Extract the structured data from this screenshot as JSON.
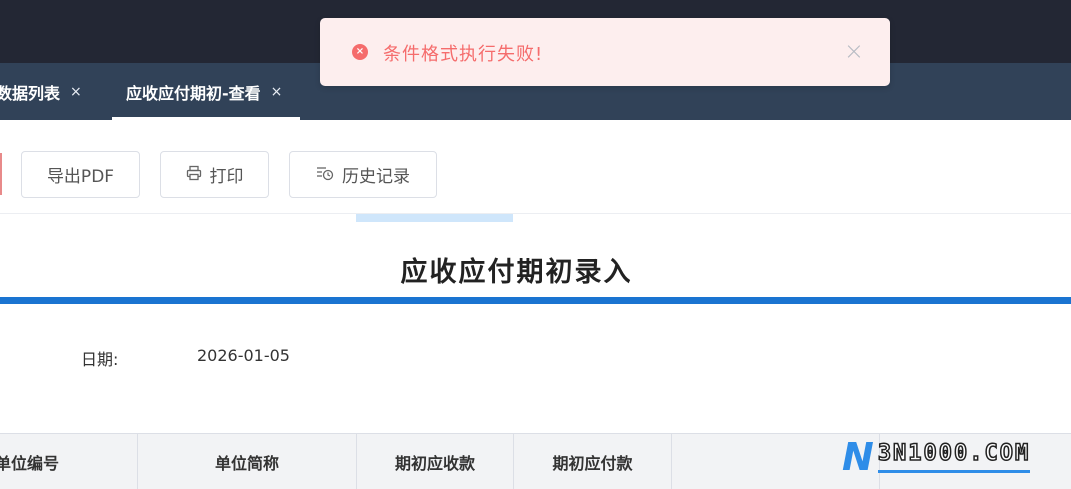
{
  "tabs": [
    {
      "label": "数据列表",
      "close": "×"
    },
    {
      "label": "应收应付期初-查看",
      "close": "×"
    }
  ],
  "toast": {
    "type": "error",
    "message": "条件格式执行失败!",
    "close": "×",
    "color": "#f56c6c"
  },
  "toolbar": {
    "export_pdf_label": "导出PDF",
    "print_label": "打印",
    "history_label": "历史记录"
  },
  "document": {
    "title": "应收应付期初录入",
    "date_label": "日期:",
    "date_value": "2026-01-05"
  },
  "table": {
    "columns": [
      "单位编号",
      "单位简称",
      "期初应收款",
      "期初应付款",
      ""
    ]
  },
  "watermark": {
    "logo": "N",
    "text": "3N1000.COM"
  },
  "colors": {
    "topbar": "#232734",
    "tabbar": "#314258",
    "accent_blue": "#1a74d1",
    "toast_bg": "#fdeeee"
  }
}
